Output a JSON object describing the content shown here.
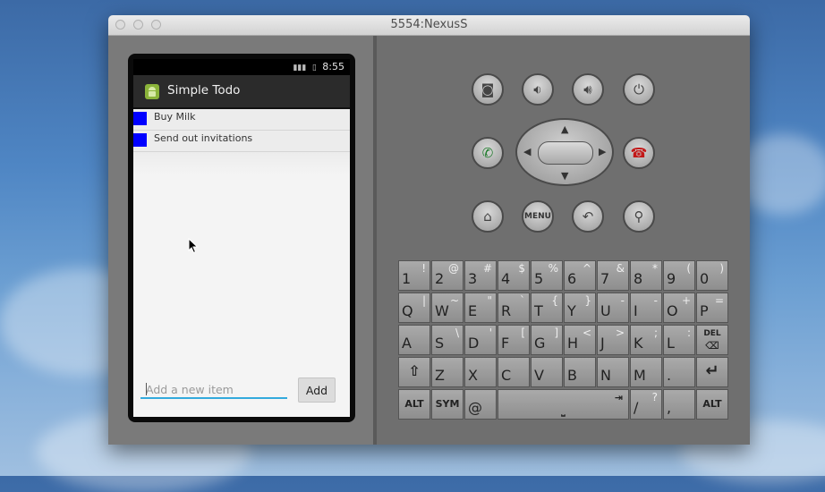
{
  "window": {
    "title": "5554:NexusS"
  },
  "phone": {
    "status": {
      "time": "8:55"
    },
    "app": {
      "title": "Simple Todo"
    },
    "items": [
      {
        "label": "Buy Milk",
        "color": "#0000ff"
      },
      {
        "label": "Send out invitations",
        "color": "#0000ff"
      }
    ],
    "input": {
      "placeholder": "Add a new item",
      "value": ""
    },
    "add_label": "Add"
  },
  "hw_buttons": {
    "menu_label": "MENU"
  },
  "keyboard": {
    "row1": [
      [
        "1",
        "!"
      ],
      [
        "2",
        "@"
      ],
      [
        "3",
        "#"
      ],
      [
        "4",
        "$"
      ],
      [
        "5",
        "%"
      ],
      [
        "6",
        "^"
      ],
      [
        "7",
        "&"
      ],
      [
        "8",
        "*"
      ],
      [
        "9",
        "("
      ],
      [
        "0",
        ")"
      ]
    ],
    "row2": [
      [
        "Q",
        "|"
      ],
      [
        "W",
        "~"
      ],
      [
        "E",
        "\""
      ],
      [
        "R",
        "`"
      ],
      [
        "T",
        "{"
      ],
      [
        "Y",
        "}"
      ],
      [
        "U",
        "-"
      ],
      [
        "I",
        "-"
      ],
      [
        "O",
        "+"
      ],
      [
        "P",
        "="
      ]
    ],
    "row3": [
      [
        "A",
        ""
      ],
      [
        "S",
        "\\"
      ],
      [
        "D",
        "'"
      ],
      [
        "F",
        "["
      ],
      [
        "G",
        "]"
      ],
      [
        "H",
        "<"
      ],
      [
        "J",
        ">"
      ],
      [
        "K",
        ";"
      ],
      [
        "L",
        ":"
      ]
    ],
    "row4": [
      [
        "Z",
        ""
      ],
      [
        "X",
        ""
      ],
      [
        "C",
        ""
      ],
      [
        "V",
        ""
      ],
      [
        "B",
        ""
      ],
      [
        "N",
        ""
      ],
      [
        "M",
        ""
      ],
      [
        ".",
        ""
      ]
    ],
    "row5": {
      "alt": "ALT",
      "sym": "SYM",
      "at": "@",
      "slash": "/",
      "question": "?",
      "comma": ",",
      "alt2": "ALT"
    },
    "del_label": "DEL"
  }
}
